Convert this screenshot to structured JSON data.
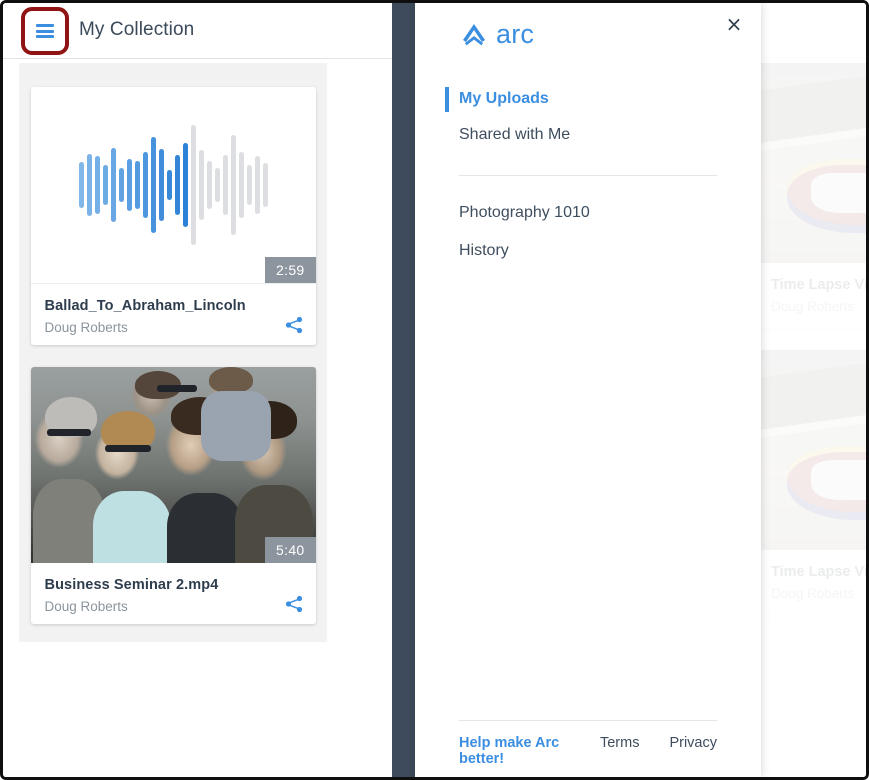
{
  "window": {
    "title": "My Collection"
  },
  "topbar": {
    "menu_button_name": "hamburger-menu-icon",
    "title": "My Collection",
    "highlight_color": "#8f1413",
    "icon_color": "#3b8ee0"
  },
  "collection": {
    "cards": [
      {
        "type": "audio",
        "title": "Ballad_To_Abraham_Lincoln",
        "author": "Doug Roberts",
        "duration": "2:59",
        "share_label": "share-icon",
        "waveform": {
          "progress_index": 14,
          "played_color": "#3b8ee0",
          "unplayed_color": "#dcdee1",
          "heights": [
            46,
            62,
            58,
            40,
            74,
            34,
            52,
            48,
            66,
            96,
            72,
            30,
            60,
            84,
            120,
            70,
            48,
            34,
            60,
            100,
            66,
            40,
            58,
            44
          ]
        }
      },
      {
        "type": "video",
        "title": "Business Seminar 2.mp4",
        "author": "Doug Roberts",
        "duration": "5:40",
        "share_label": "share-icon"
      }
    ]
  },
  "background_cards": [
    {
      "title": "Time Lapse Vid",
      "author": "Doug Roberts"
    },
    {
      "title": "Time Lapse Vid",
      "author": "Doug Roberts"
    }
  ],
  "drawer": {
    "brand": {
      "word": "arc",
      "color": "#3b8ee0"
    },
    "close_label": "×",
    "nav_primary": [
      {
        "label": "My Uploads",
        "active": true
      },
      {
        "label": "Shared with Me",
        "active": false
      }
    ],
    "nav_secondary": [
      {
        "label": "Photography 1010"
      },
      {
        "label": "History"
      }
    ],
    "footer": {
      "help": "Help make Arc better!",
      "terms": "Terms",
      "privacy": "Privacy"
    }
  }
}
